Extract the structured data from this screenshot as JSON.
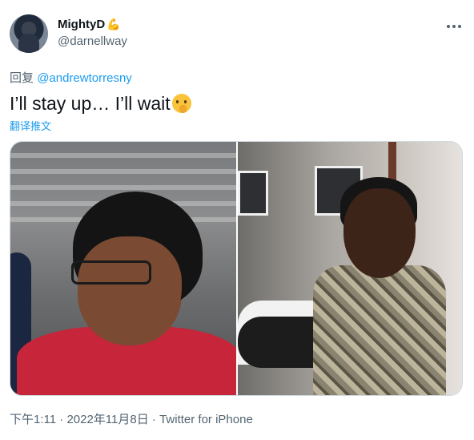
{
  "author": {
    "display_name": "MightyD",
    "name_emoji": "💪",
    "handle": "@darnellway"
  },
  "reply": {
    "prefix": "回复",
    "mention": "@andrewtorresny"
  },
  "tweet": {
    "text": "I’ll stay up… I’ll wait",
    "emoji": "🤫",
    "translate_label": "翻译推文"
  },
  "media": {
    "photo_count": 2
  },
  "meta": {
    "time": "下午1:11",
    "separator": " · ",
    "date": "2022年11月8日",
    "source": "Twitter for iPhone"
  },
  "colors": {
    "link": "#1d9bf0",
    "secondary_text": "#536471",
    "primary_text": "#0f1419"
  }
}
